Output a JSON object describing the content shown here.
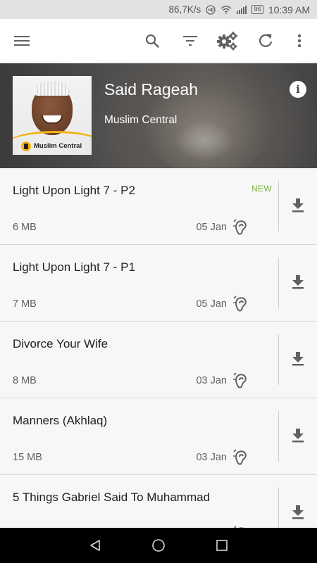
{
  "status_bar": {
    "net_speed": "86,7K/s",
    "battery": "96",
    "time": "10:39 AM",
    "icons": [
      "hd-call-icon",
      "wifi-icon",
      "signal-icon",
      "battery-icon"
    ]
  },
  "toolbar": {
    "icons": [
      "menu-icon",
      "search-icon",
      "filter-icon",
      "settings-icon",
      "refresh-icon",
      "more-vert-icon"
    ]
  },
  "header": {
    "title": "Said Rageah",
    "author": "Muslim Central",
    "artwork_logo_text": "Muslim Central",
    "info_icon": "info-icon"
  },
  "episodes": [
    {
      "title": "Light Upon Light 7 - P2",
      "badge": "NEW",
      "size": "6 MB",
      "date": "05 Jan"
    },
    {
      "title": "Light Upon Light 7 - P1",
      "badge": "",
      "size": "7 MB",
      "date": "05 Jan"
    },
    {
      "title": "Divorce Your Wife",
      "badge": "",
      "size": "8 MB",
      "date": "03 Jan"
    },
    {
      "title": "Manners (Akhlaq)",
      "badge": "",
      "size": "15 MB",
      "date": "03 Jan"
    },
    {
      "title": "5 Things Gabriel Said To Muhammad",
      "badge": "",
      "size": "",
      "date": ""
    }
  ],
  "nav_bar": {
    "icons": [
      "back-icon",
      "home-icon",
      "recents-icon"
    ]
  },
  "colors": {
    "new_badge": "#7cb342",
    "accent_logo": "#f4b213",
    "toolbar_bg": "#ffffff",
    "list_bg": "#f7f7f7"
  }
}
